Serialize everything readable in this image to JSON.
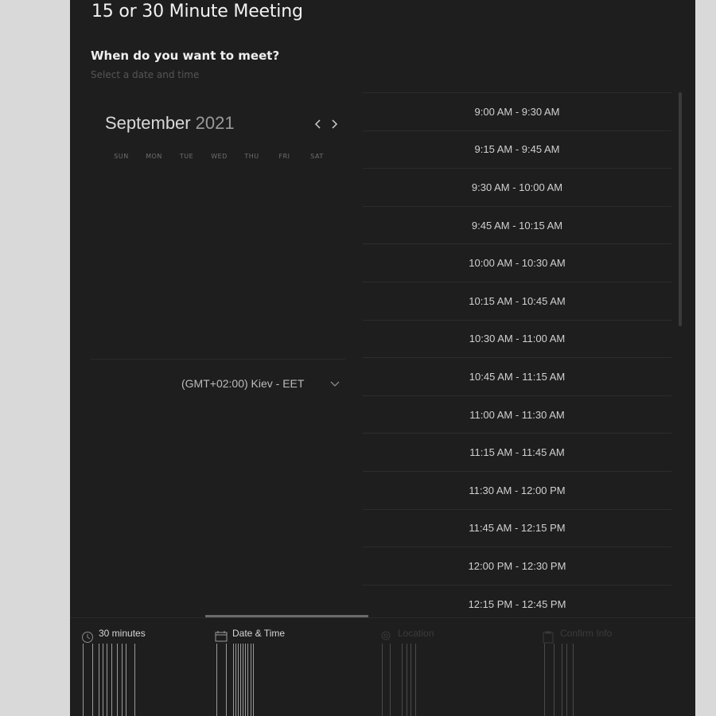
{
  "page": {
    "title": "15 or 30 Minute Meeting",
    "question": "When do you want to meet?",
    "subtitle": "Select a date and time"
  },
  "calendar": {
    "month": "September",
    "year": "2021",
    "prev_icon": "chevron-left-icon",
    "next_icon": "chevron-right-icon",
    "weekdays": [
      "SUN",
      "MON",
      "TUE",
      "WED",
      "THU",
      "FRI",
      "SAT"
    ]
  },
  "timezone": {
    "label": "(GMT+02:00) Kiev - EET",
    "icon": "chevron-down-icon"
  },
  "time_slots": [
    "9:00 AM - 9:30 AM",
    "9:15 AM - 9:45 AM",
    "9:30 AM - 10:00 AM",
    "9:45 AM - 10:15 AM",
    "10:00 AM - 10:30 AM",
    "10:15 AM - 10:45 AM",
    "10:30 AM - 11:00 AM",
    "10:45 AM - 11:15 AM",
    "11:00 AM - 11:30 AM",
    "11:15 AM - 11:45 AM",
    "11:30 AM - 12:00 PM",
    "11:45 AM - 12:15 PM",
    "12:00 PM - 12:30 PM",
    "12:15 PM - 12:45 PM"
  ],
  "steps": [
    {
      "label": "30 minutes",
      "icon": "clock-icon",
      "state": "done"
    },
    {
      "label": "Date & Time",
      "icon": "calendar-icon",
      "state": "active"
    },
    {
      "label": "Location",
      "icon": "location-pin-icon",
      "state": "disabled"
    },
    {
      "label": "Confirm Info",
      "icon": "clipboard-icon",
      "state": "disabled"
    }
  ],
  "colors": {
    "page_background": "#d9d9d9",
    "panel_background": "#1e1e1e",
    "text_primary": "#e8e8e8",
    "text_muted": "#555555",
    "divider": "#2c2c2c"
  }
}
